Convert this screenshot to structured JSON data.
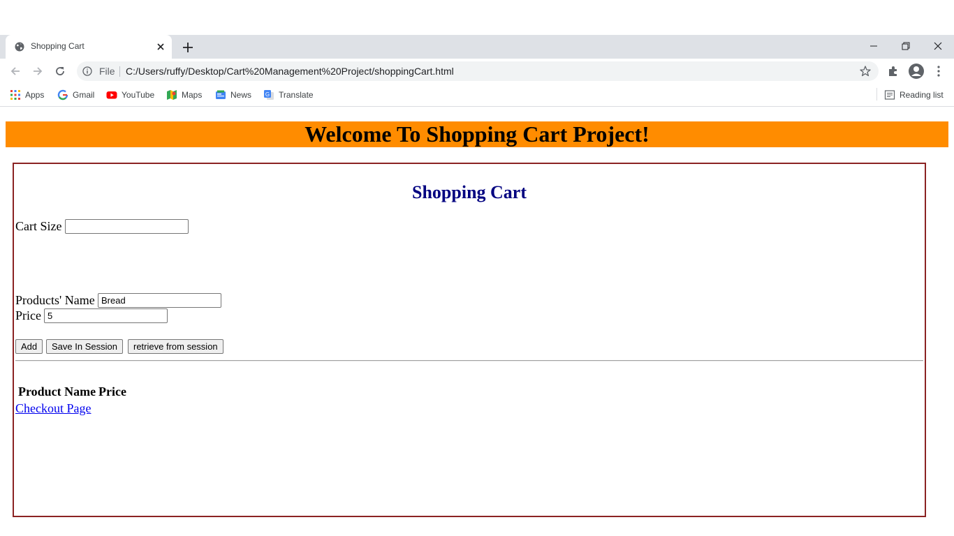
{
  "browser": {
    "tab_title": "Shopping Cart",
    "file_label": "File",
    "url": "C:/Users/ruffy/Desktop/Cart%20Management%20Project/shoppingCart.html",
    "bookmarks": [
      {
        "label": "Apps",
        "icon": "apps-grid-icon"
      },
      {
        "label": "Gmail",
        "icon": "google-icon"
      },
      {
        "label": "YouTube",
        "icon": "youtube-icon"
      },
      {
        "label": "Maps",
        "icon": "maps-icon"
      },
      {
        "label": "News",
        "icon": "news-icon"
      },
      {
        "label": "Translate",
        "icon": "translate-icon"
      }
    ],
    "reading_list": "Reading list"
  },
  "page": {
    "banner_title": "Welcome To Shopping Cart Project!",
    "banner_color": "#ff8c00",
    "cart_title": "Shopping Cart",
    "cart_size_label": "Cart Size",
    "cart_size_value": "",
    "product_name_label": "Products' Name",
    "product_name_value": "Bread",
    "price_label": "Price",
    "price_value": "5",
    "buttons": {
      "add": "Add",
      "save": "Save In Session",
      "retrieve": "retrieve from session"
    },
    "table_headers": [
      "Product Name",
      "Price"
    ],
    "checkout_link": "Checkout Page"
  }
}
